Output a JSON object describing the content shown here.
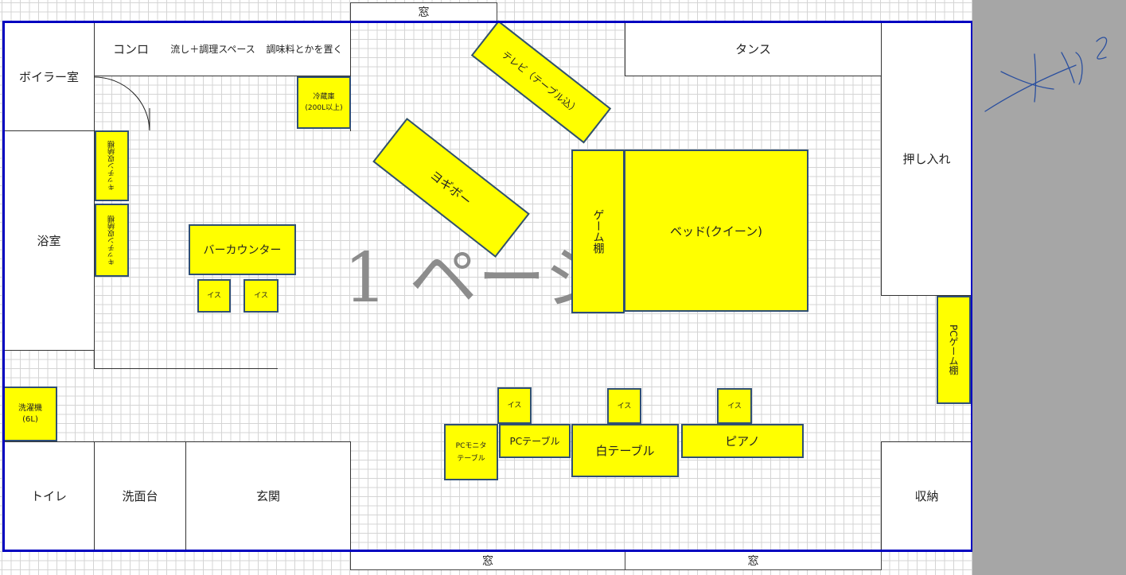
{
  "windows": {
    "top": "窓",
    "bottom_left": "窓",
    "bottom_right": "窓"
  },
  "rooms": {
    "boiler": "ボイラー室",
    "stove": "コンロ",
    "sink": "流し＋調理スペース",
    "seasoning": "調味料とかを置く",
    "bath": "浴室",
    "tansu": "タンス",
    "oshiire": "押し入れ",
    "toilet": "トイレ",
    "washbasin": "洗面台",
    "entrance": "玄関",
    "storage": "収納"
  },
  "furniture": {
    "fridge_line1": "冷蔵庫",
    "fridge_line2": "(200L以上)",
    "kitchen_cab1": "キッチン収納棚",
    "kitchen_cab2": "キッチン収納棚",
    "bar_counter": "バーカウンター",
    "chair": "イス",
    "washer_line1": "洗濯機",
    "washer_line2": "(6L)",
    "tv": "テレビ（テーブル込）",
    "yogibo": "ヨギボー",
    "game_shelf": "ゲーム棚",
    "bed": "ベッド(クイーン)",
    "pc_game_shelf": "PCゲーム棚",
    "pc_monitor_line1": "PCモニタ",
    "pc_monitor_line2": "テーブル",
    "pc_table": "PCテーブル",
    "white_table": "白テーブル",
    "piano": "ピアノ"
  },
  "watermark": "1 ページ",
  "colors": {
    "furniture_fill": "#ffff00",
    "furniture_border": "#2f4f74",
    "wall": "#0000c0",
    "annotation": "#2a4f9f"
  }
}
